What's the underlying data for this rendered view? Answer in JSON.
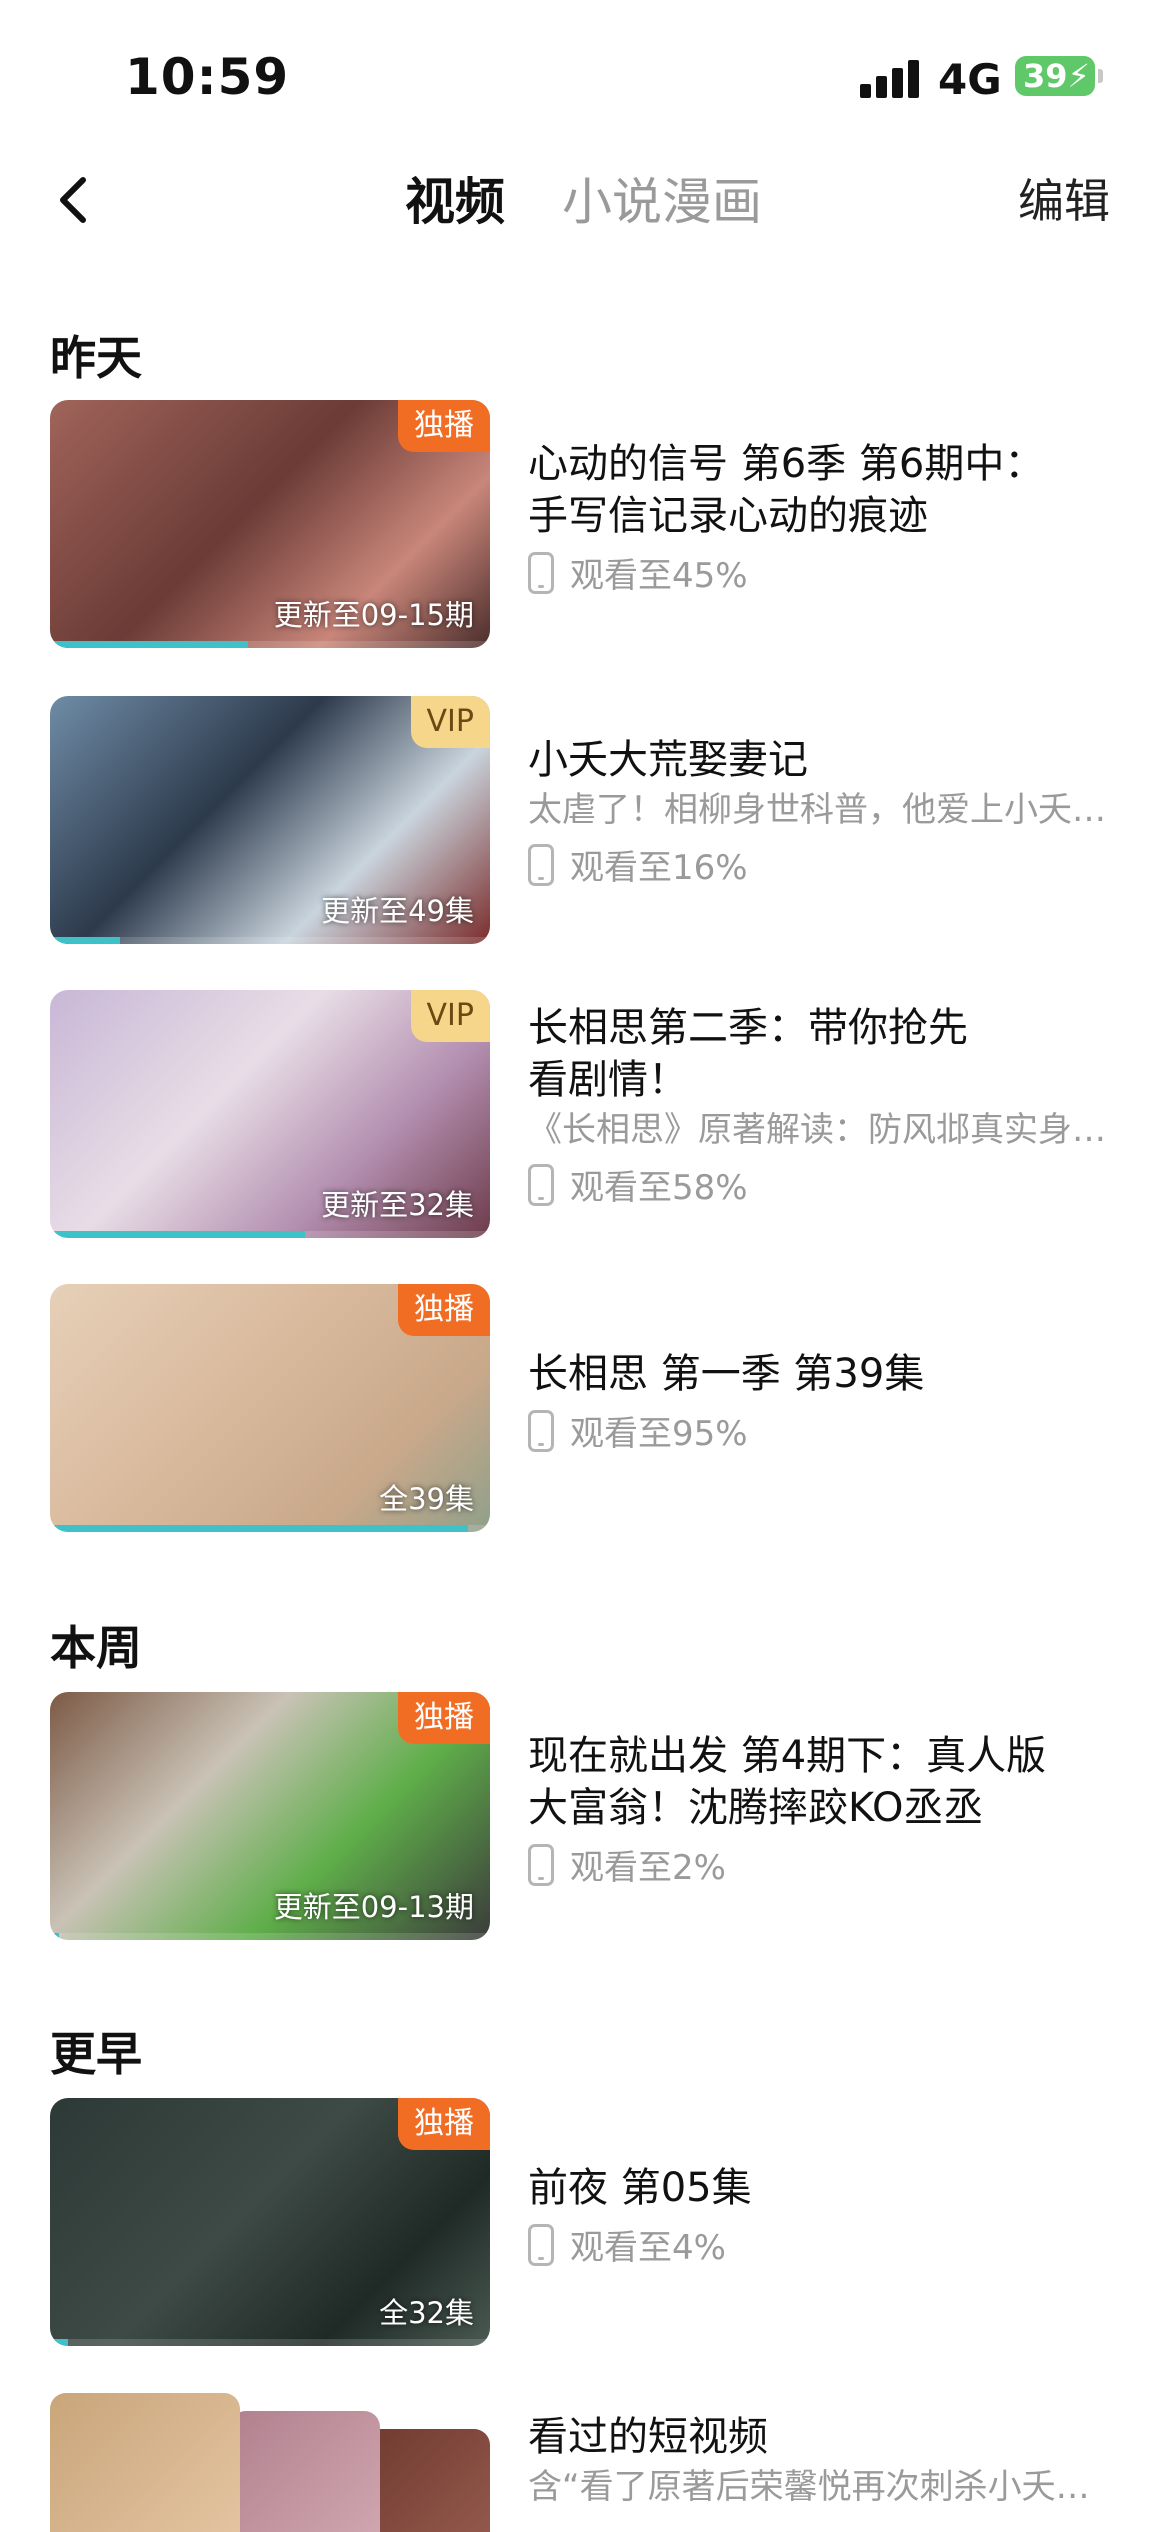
{
  "status_bar": {
    "time": "10:59",
    "network": "4G",
    "battery": "39"
  },
  "nav": {
    "tabs": [
      {
        "label": "视频"
      },
      {
        "label": "小说漫画"
      }
    ],
    "edit_label": "编辑"
  },
  "colors": {
    "exclusive_badge": "#f26d24",
    "vip_badge": "#f6d68a",
    "progress": "#3fc1c9",
    "secondary_text": "#9a9a9a"
  },
  "sections": [
    {
      "title": "昨天",
      "items": [
        {
          "badge": "独播",
          "overlay": "更新至09-15期",
          "title_line1": "心动的信号 第6季 第6期中：",
          "title_line2": "手写信记录心动的痕迹",
          "desc": "",
          "watch": "观看至45%",
          "progress": 0.45
        },
        {
          "badge": "VIP",
          "overlay": "更新至49集",
          "title_line1": "小夭大荒娶妻记",
          "title_line2": "",
          "desc": "太虐了！相柳身世科普，他爱上小夭…",
          "watch": "观看至16%",
          "progress": 0.16
        },
        {
          "badge": "VIP",
          "overlay": "更新至32集",
          "title_line1": "长相思第二季：带你抢先",
          "title_line2": "看剧情！",
          "desc": "《长相思》原著解读：防风邶真实身份…",
          "watch": "观看至58%",
          "progress": 0.58
        },
        {
          "badge": "独播",
          "overlay": "全39集",
          "title_line1": "长相思 第一季 第39集",
          "title_line2": "",
          "desc": "",
          "watch": "观看至95%",
          "progress": 0.95
        }
      ]
    },
    {
      "title": "本周",
      "items": [
        {
          "badge": "独播",
          "overlay": "更新至09-13期",
          "title_line1": "现在就出发 第4期下：真人版",
          "title_line2": "大富翁！沈腾摔跤KO丞丞",
          "desc": "",
          "watch": "观看至2%",
          "progress": 0.02
        }
      ]
    },
    {
      "title": "更早",
      "items": [
        {
          "badge": "独播",
          "overlay": "全32集",
          "title_line1": "前夜 第05集",
          "title_line2": "",
          "desc": "",
          "watch": "观看至4%",
          "progress": 0.04
        },
        {
          "badge": "",
          "overlay": "",
          "title_line1": "看过的短视频",
          "title_line2": "",
          "desc": "含“看了原著后荣馨悦再次刺杀小夭…",
          "watch": "",
          "progress": 0
        }
      ]
    }
  ]
}
